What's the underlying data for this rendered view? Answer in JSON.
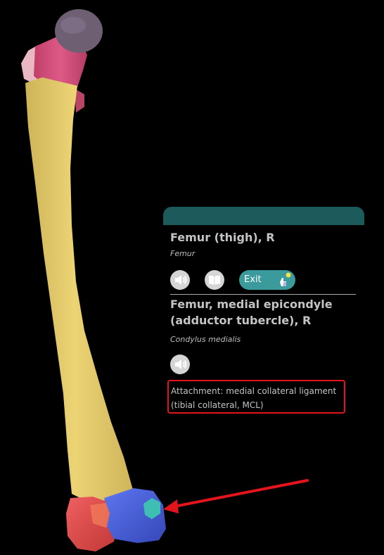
{
  "colors": {
    "background": "#000000",
    "panel_header": "#1d5a5b",
    "accent_button": "#3a9a9c",
    "femur_shaft": "#e7cf6a",
    "femoral_neck": "#d6507c",
    "femoral_head": "#6e5f73",
    "lateral_condyle": "#e04b4b",
    "medial_condyle": "#4b63e0",
    "medial_epicondyle_highlight": "#3fbfb3",
    "annotation_red": "#e4141c"
  },
  "panel": {
    "structure_title": "Femur (thigh), R",
    "structure_latin": "Femur",
    "exit_label": "Exit",
    "detail_title_line1": "Femur, medial epicondyle",
    "detail_title_line2": "(adductor tubercle), R",
    "detail_latin": "Condylus medialis",
    "attachment_line1": "Attachment: medial collateral ligament",
    "attachment_line2": "(tibial collateral, MCL)",
    "icons": [
      "speaker-icon",
      "book-icon",
      "hand-pointer-icon"
    ]
  }
}
